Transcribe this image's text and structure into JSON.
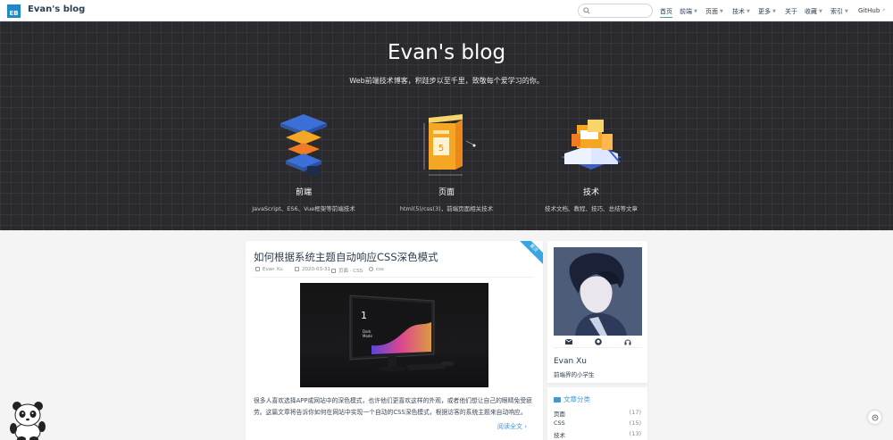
{
  "navbar": {
    "logo_text": "EB",
    "site_name": "Evan's blog",
    "search": {
      "placeholder": "",
      "value": ""
    },
    "items": [
      {
        "label": "首页",
        "active": true,
        "dropdown": false
      },
      {
        "label": "前端",
        "dropdown": true
      },
      {
        "label": "页面",
        "dropdown": true
      },
      {
        "label": "技术",
        "dropdown": true
      },
      {
        "label": "更多",
        "dropdown": true
      },
      {
        "label": "关于",
        "dropdown": false
      },
      {
        "label": "收藏",
        "dropdown": true
      },
      {
        "label": "索引",
        "dropdown": true
      },
      {
        "label": "GitHub",
        "external": true
      }
    ]
  },
  "hero": {
    "title": "Evan's blog",
    "subtitle": "Web前端技术博客，积跬步以至千里，致敬每个爱学习的你。",
    "features": [
      {
        "title": "前端",
        "desc": "JavaScript、ES6、Vue框架等前端技术",
        "icon": "layers-stack-icon"
      },
      {
        "title": "页面",
        "desc": "html(5)/css(3)，前端页面相关技术",
        "icon": "html5-page-icon"
      },
      {
        "title": "技术",
        "desc": "技术文档、教程、技巧、总结等文章",
        "icon": "open-book-icon"
      }
    ]
  },
  "post": {
    "ribbon": "置顶",
    "title": "如何根据系统主题自动响应CSS深色模式",
    "author": "Evan Xu",
    "date": "2020-03-31",
    "category": "页面 · CSS",
    "tag": "css",
    "excerpt": "很多人喜欢选择APP或网站中的深色模式，也许他们更喜欢这样的外观，或者他们想让自己的眼睛免受疲劳。这篇文章将告诉你如何在网站中实现一个自动的CSS深色模式，根据访客的系统主题来自动响应。",
    "read_more": "阅读全文",
    "image_labels": {
      "number": "1",
      "line1": "Dark",
      "line2": "Mode"
    }
  },
  "profile": {
    "name": "Evan Xu",
    "bio": "前端界的小学生",
    "social": [
      "mail-icon",
      "github-icon",
      "headphones-icon"
    ]
  },
  "categories": {
    "heading": "文章分类",
    "items": [
      {
        "name": "页面",
        "count": "(17)"
      },
      {
        "name": "CSS",
        "count": "(15)"
      },
      {
        "name": "技术",
        "count": "(13)"
      }
    ]
  },
  "colors": {
    "accent": "#3a9ad9",
    "hero_bg": "#2a2a2e",
    "nav_active": "#3eaf7c",
    "ribbon": "#3aa6e0"
  }
}
